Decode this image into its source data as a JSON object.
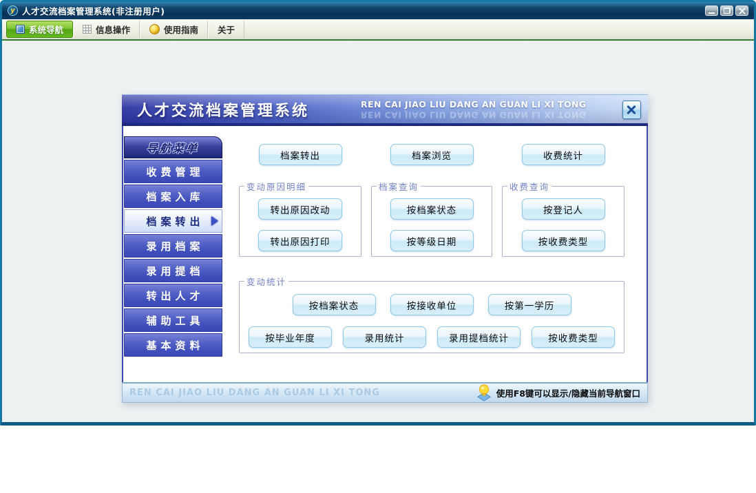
{
  "window": {
    "title": "人才交流档案管理系统(非注册用户)",
    "logo_text": "y",
    "controls": [
      {
        "icon": "minimize-icon"
      },
      {
        "icon": "restore-icon"
      },
      {
        "icon": "close-icon"
      }
    ]
  },
  "toolbar": {
    "tabs": [
      {
        "label": "系统导航",
        "icon": "blue-square-icon",
        "active": true
      },
      {
        "label": "信息操作",
        "icon": "grid-icon",
        "active": false
      },
      {
        "label": "使用指南",
        "icon": "coin-icon",
        "active": false
      },
      {
        "label": "关于",
        "icon": "",
        "active": false
      }
    ]
  },
  "dialog": {
    "title": "人才交流档案管理系统",
    "subtitle": "REN CAI JIAO LIU DANG AN GUAN LI XI TONG",
    "close_icon": "close-icon",
    "sidebar": {
      "header": "导航菜单",
      "items": [
        {
          "label": "收费管理",
          "active": false
        },
        {
          "label": "档案入库",
          "active": false
        },
        {
          "label": "档案转出",
          "active": true
        },
        {
          "label": "录用档案",
          "active": false
        },
        {
          "label": "录用提档",
          "active": false
        },
        {
          "label": "转出人才",
          "active": false
        },
        {
          "label": "辅助工具",
          "active": false
        },
        {
          "label": "基本资料",
          "active": false
        }
      ]
    },
    "quick_buttons": [
      {
        "label": "档案转出"
      },
      {
        "label": "档案浏览"
      },
      {
        "label": "收费统计"
      }
    ],
    "groups": [
      {
        "title": "变动原因明细",
        "buttons": [
          {
            "label": "转出原因改动"
          },
          {
            "label": "转出原因打印"
          }
        ]
      },
      {
        "title": "档案查询",
        "buttons": [
          {
            "label": "按档案状态"
          },
          {
            "label": "按等级日期"
          }
        ]
      },
      {
        "title": "收费查询",
        "buttons": [
          {
            "label": "按登记人"
          },
          {
            "label": "按收费类型"
          }
        ]
      }
    ],
    "stats_group": {
      "title": "变动统计",
      "row1": [
        {
          "label": "按档案状态"
        },
        {
          "label": "按接收单位"
        },
        {
          "label": "按第一学历"
        }
      ],
      "row2": [
        {
          "label": "按毕业年度"
        },
        {
          "label": "录用统计"
        },
        {
          "label": "录用提档统计"
        },
        {
          "label": "按收费类型"
        }
      ]
    },
    "status_bar": {
      "left_text": "REN CAI JIAO LIU DANG AN GUAN LI XI TONG",
      "right_text": "使用F8键可以显示/隐藏当前导航窗口",
      "bulb_icon": "lightbulb-icon"
    }
  },
  "colors": {
    "titlebar_navy": "#0d3a63",
    "window_border_teal": "#1577a3",
    "active_tab_green": "#5fae1f",
    "menubar_underline_green": "#2f7d2f",
    "dialog_header_left": "#2b36a2",
    "dialog_header_right": "#c9dbf6",
    "sidebar_item_blue": "#4c5cc4",
    "nav_header_navy": "#1f2878",
    "button_border_blue": "#8fc8e8",
    "button_fill_blue": "#cceaf9",
    "groupbox_label_blue": "#7080c8",
    "status_text_blue": "#a9cbe6"
  }
}
